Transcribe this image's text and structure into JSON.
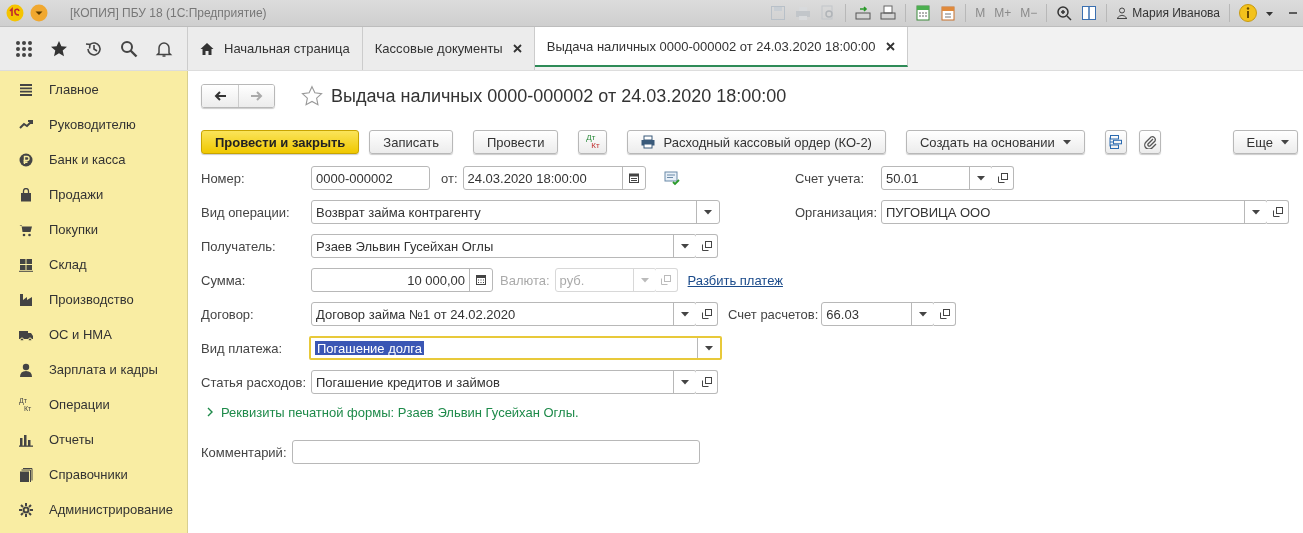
{
  "window": {
    "title": "[КОПИЯ] ПБУ 18  (1С:Предприятие)",
    "memory_buttons": [
      {
        "label": "M",
        "disabled": true
      },
      {
        "label": "M+",
        "disabled": true
      },
      {
        "label": "M−",
        "disabled": true
      }
    ],
    "user": "Мария Иванова"
  },
  "tabs": [
    {
      "label": "Начальная страница",
      "kind": "home",
      "selected": false
    },
    {
      "label": "Кассовые документы",
      "kind": "doc",
      "selected": false
    },
    {
      "label": "Выдача наличных 0000-000002 от 24.03.2020 18:00:00",
      "kind": "doc",
      "selected": true
    }
  ],
  "sidebar": {
    "items": [
      {
        "label": "Главное",
        "kind": "menu"
      },
      {
        "label": "Руководителю",
        "kind": "trend"
      },
      {
        "label": "Банк и касса",
        "kind": "ruble"
      },
      {
        "label": "Продажи",
        "kind": "bag"
      },
      {
        "label": "Покупки",
        "kind": "cart"
      },
      {
        "label": "Склад",
        "kind": "grid"
      },
      {
        "label": "Производство",
        "kind": "factory"
      },
      {
        "label": "ОС и НМА",
        "kind": "truck"
      },
      {
        "label": "Зарплата и кадры",
        "kind": "person"
      },
      {
        "label": "Операции",
        "kind": "dtkt",
        "icon_text": [
          "Дт",
          "Кт"
        ]
      },
      {
        "label": "Отчеты",
        "kind": "bars"
      },
      {
        "label": "Справочники",
        "kind": "books"
      },
      {
        "label": "Администрирование",
        "kind": "gear"
      }
    ]
  },
  "document": {
    "title": "Выдача наличных 0000-000002 от 24.03.2020 18:00:00"
  },
  "toolbar": [
    {
      "kind": "primary",
      "label": "Провести и закрыть"
    },
    {
      "kind": "plain",
      "label": "Записать"
    },
    {
      "kind": "plain",
      "label": "Провести"
    },
    {
      "kind": "dtkt",
      "icon_text": [
        "Дт",
        "Кт"
      ]
    },
    {
      "kind": "print",
      "label": "Расходный кассовый ордер (КО-2)"
    },
    {
      "kind": "menu",
      "label": "Создать на основании"
    },
    {
      "kind": "structure"
    },
    {
      "kind": "attach"
    },
    {
      "kind": "more",
      "label": "Еще"
    }
  ],
  "form": {
    "number": {
      "label": "Номер:",
      "value": "0000-000002"
    },
    "date": {
      "label": "от:",
      "value": "24.03.2020 18:00:00"
    },
    "account": {
      "label": "Счет учета:",
      "value": "50.01"
    },
    "operation": {
      "label": "Вид операции:",
      "value": "Возврат займа контрагенту"
    },
    "organization": {
      "label": "Организация:",
      "value": "ПУГОВИЦА ООО"
    },
    "recipient": {
      "label": "Получатель:",
      "value": "Рзаев Эльвин Гусейхан Оглы"
    },
    "amount": {
      "label": "Сумма:",
      "value": "10 000,00"
    },
    "currency": {
      "label": "Валюта:",
      "value": "руб.",
      "disabled": true
    },
    "split_link": "Разбить платеж",
    "contract": {
      "label": "Договор:",
      "value": "Договор займа №1 от 24.02.2020"
    },
    "settlement_account": {
      "label": "Счет расчетов:",
      "value": "66.03"
    },
    "payment_type": {
      "label": "Вид платежа:",
      "value": "Погашение долга",
      "focused": true
    },
    "expense_item": {
      "label": "Статья расходов:",
      "value": "Погашение кредитов и займов"
    },
    "print_details": {
      "text": "Реквизиты печатной формы: Рзаев Эльвин Гусейхан Оглы.",
      "expanded": false
    },
    "comment": {
      "label": "Комментарий:"
    }
  }
}
